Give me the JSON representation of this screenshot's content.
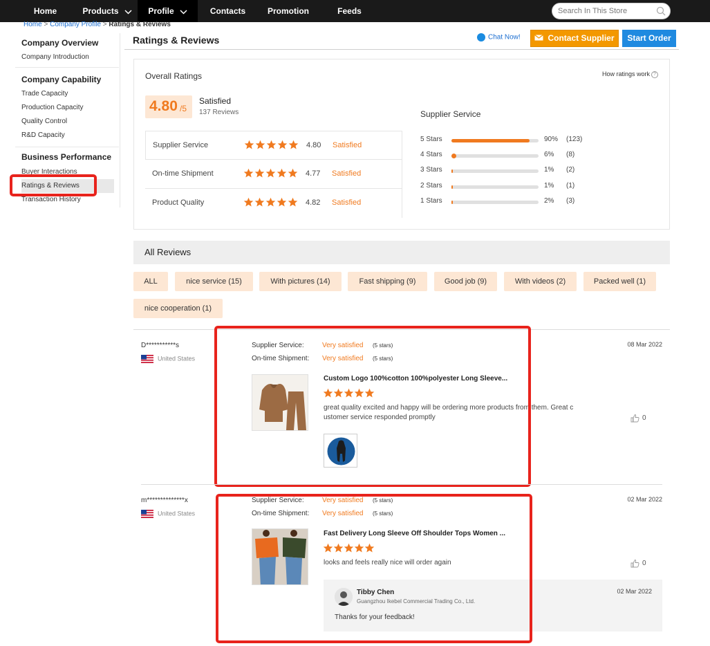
{
  "nav": {
    "items": [
      {
        "label": "Home"
      },
      {
        "label": "Products"
      },
      {
        "label": "Profile"
      },
      {
        "label": "Contacts"
      },
      {
        "label": "Promotion"
      },
      {
        "label": "Feeds"
      }
    ],
    "search_placeholder": "Search In This Store"
  },
  "breadcrumb": {
    "home": "Home",
    "sep": ">",
    "profile": "Company Profile",
    "current": "Ratings & Reviews"
  },
  "sidebar": {
    "groups": [
      {
        "title": "Company Overview",
        "items": [
          "Company Introduction"
        ]
      },
      {
        "title": "Company Capability",
        "items": [
          "Trade Capacity",
          "Production Capacity",
          "Quality Control",
          "R&D Capacity"
        ]
      },
      {
        "title": "Business Performance",
        "items": [
          "Buyer Interactions",
          "Ratings & Reviews",
          "Transaction History"
        ]
      }
    ],
    "active_item": "Ratings & Reviews"
  },
  "header": {
    "title": "Ratings & Reviews",
    "chat": "Chat Now!",
    "contact": "Contact Supplier",
    "order": "Start Order"
  },
  "overall": {
    "title": "Overall Ratings",
    "how": "How ratings work",
    "score": "4.80",
    "out_of": "/5",
    "label": "Satisfied",
    "count": "137 Reviews",
    "metrics": [
      {
        "name": "Supplier Service",
        "value": "4.80",
        "label": "Satisfied",
        "stars": 5
      },
      {
        "name": "On-time Shipment",
        "value": "4.77",
        "label": "Satisfied",
        "stars": 5
      },
      {
        "name": "Product Quality",
        "value": "4.82",
        "label": "Satisfied",
        "stars": 5
      }
    ],
    "supplier_service": {
      "title": "Supplier Service",
      "rows": [
        {
          "label": "5  Stars",
          "pct": "90%",
          "count": "(123)",
          "fill": 0.9
        },
        {
          "label": "4  Stars",
          "pct": "6%",
          "count": "(8)",
          "fill": 0.06
        },
        {
          "label": "3  Stars",
          "pct": "1%",
          "count": "(2)",
          "fill": 0.01
        },
        {
          "label": "2  Stars",
          "pct": "1%",
          "count": "(1)",
          "fill": 0.01
        },
        {
          "label": "1  Stars",
          "pct": "2%",
          "count": "(3)",
          "fill": 0.02
        }
      ]
    }
  },
  "reviews": {
    "title": "All Reviews",
    "tags": [
      "ALL",
      "nice service (15)",
      "With pictures (14)",
      "Fast shipping (9)",
      "Good job (9)",
      "With videos (2)",
      "Packed well (1)",
      "nice cooperation (1)"
    ],
    "items": [
      {
        "reviewer": "D***********s",
        "country": "United States",
        "date": "08 Mar 2022",
        "supplier_service_label": "Supplier Service:",
        "supplier_service": "Very satisfied",
        "supplier_service_stars": "(5 stars)",
        "shipment_label": "On-time Shipment:",
        "shipment": "Very satisfied",
        "shipment_stars": "(5 stars)",
        "product_title": "Custom Logo 100%cotton 100%polyester Long Sleeve...",
        "text_line1": "great quality excited and happy will be ordering more products from them. Great c",
        "text_line2": "ustomer service responded promptly",
        "likes": "0"
      },
      {
        "reviewer": "m**************x",
        "country": "United States",
        "date": "02 Mar 2022",
        "supplier_service_label": "Supplier Service:",
        "supplier_service": "Very satisfied",
        "supplier_service_stars": "(5 stars)",
        "shipment_label": "On-time Shipment:",
        "shipment": "Very satisfied",
        "shipment_stars": "(5 stars)",
        "product_title": "Fast Delivery Long Sleeve Off Shoulder Tops Women ...",
        "text_line1": "looks and feels really nice will order again",
        "likes": "0",
        "reply": {
          "name": "Tibby Chen",
          "company": "Guangzhou Ikebel Commercial Trading Co., Ltd.",
          "date": "02 Mar 2022",
          "text": "Thanks for your feedback!"
        }
      }
    ]
  },
  "colors": {
    "accent": "#f07a1f",
    "highlight_red": "#e8231c",
    "nav_bg": "#1a1a1a",
    "contact_btn": "#f39800",
    "order_btn": "#1f8ae0"
  }
}
